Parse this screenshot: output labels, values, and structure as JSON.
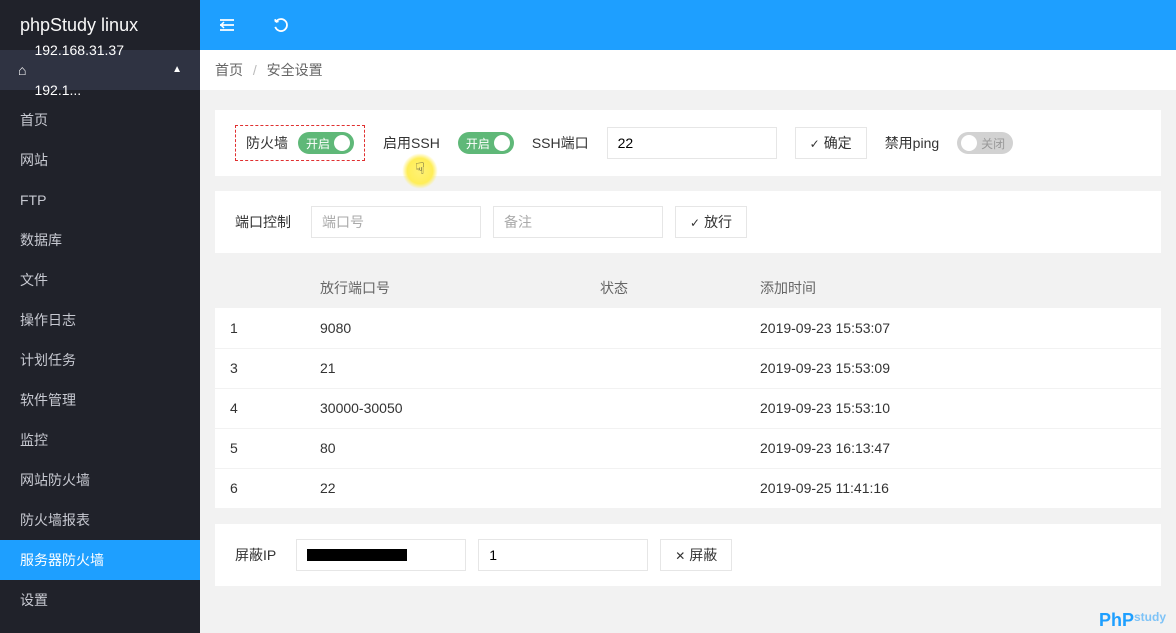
{
  "brand": "phpStudy linux",
  "ip_text": "192.168.31.37 192.1...",
  "nav": [
    {
      "label": "首页",
      "id": "home"
    },
    {
      "label": "网站",
      "id": "site"
    },
    {
      "label": "FTP",
      "id": "ftp"
    },
    {
      "label": "数据库",
      "id": "db"
    },
    {
      "label": "文件",
      "id": "file"
    },
    {
      "label": "操作日志",
      "id": "oplog"
    },
    {
      "label": "计划任务",
      "id": "cron"
    },
    {
      "label": "软件管理",
      "id": "soft"
    },
    {
      "label": "监控",
      "id": "monitor"
    },
    {
      "label": "网站防火墙",
      "id": "webfw"
    },
    {
      "label": "防火墙报表",
      "id": "fwreport"
    },
    {
      "label": "服务器防火墙",
      "id": "serverfw"
    },
    {
      "label": "设置",
      "id": "settings"
    }
  ],
  "nav_active": "服务器防火墙",
  "breadcrumb": {
    "home": "首页",
    "current": "安全设置"
  },
  "panel1": {
    "firewall_label": "防火墙",
    "firewall_switch": "开启",
    "ssh_label": "启用SSH",
    "ssh_switch": "开启",
    "ssh_port_label": "SSH端口",
    "ssh_port_value": "22",
    "confirm_btn": "确定",
    "ping_label": "禁用ping",
    "ping_switch": "关闭"
  },
  "panel2": {
    "label": "端口控制",
    "port_placeholder": "端口号",
    "remark_placeholder": "备注",
    "allow_btn": "放行"
  },
  "table": {
    "headers": [
      "",
      "放行端口号",
      "状态",
      "添加时间"
    ],
    "rows": [
      {
        "idx": "1",
        "port": "9080",
        "status": "",
        "time": "2019-09-23 15:53:07"
      },
      {
        "idx": "3",
        "port": "21",
        "status": "",
        "time": "2019-09-23 15:53:09"
      },
      {
        "idx": "4",
        "port": "30000-30050",
        "status": "",
        "time": "2019-09-23 15:53:10"
      },
      {
        "idx": "5",
        "port": "80",
        "status": "",
        "time": "2019-09-23 16:13:47"
      },
      {
        "idx": "6",
        "port": "22",
        "status": "",
        "time": "2019-09-25 11:41:16"
      }
    ]
  },
  "panel3": {
    "label": "屏蔽IP",
    "count_value": "1",
    "block_btn": "屏蔽"
  },
  "watermark": {
    "p": "P",
    "h": "h",
    "p2": "P",
    "s": "study"
  }
}
